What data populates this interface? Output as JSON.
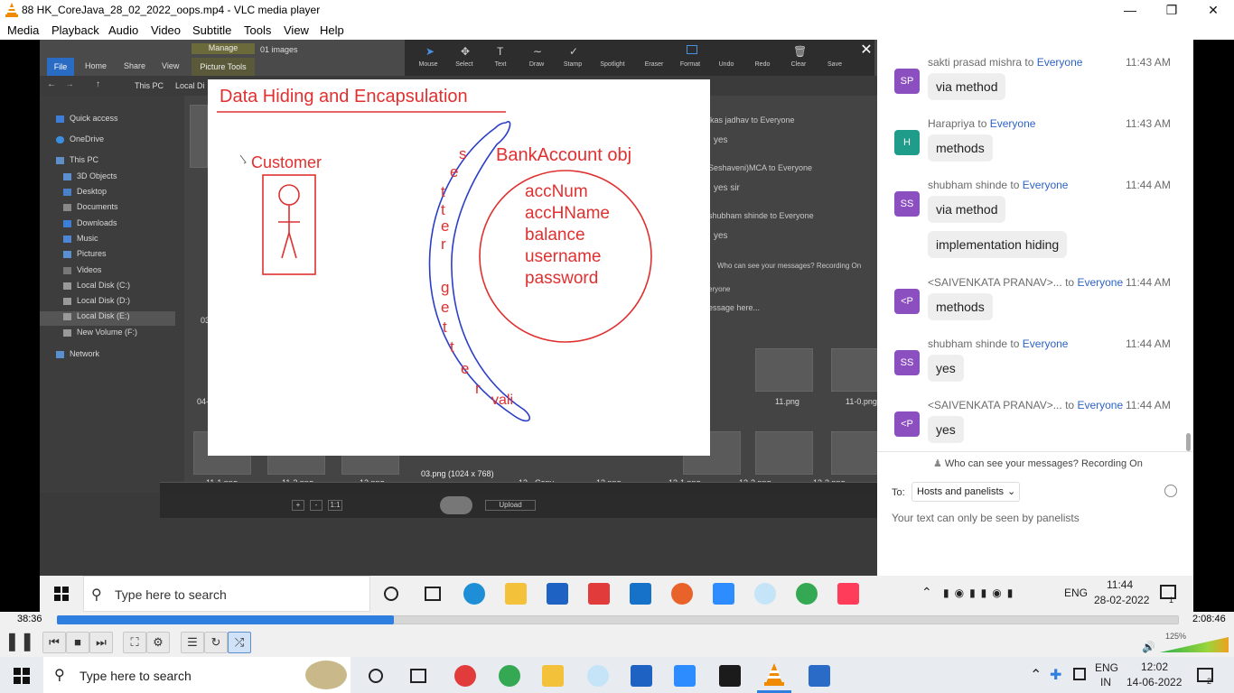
{
  "window": {
    "title": "88 HK_CoreJava_28_02_2022_oops.mp4 - VLC media player"
  },
  "menu": [
    "Media",
    "Playback",
    "Audio",
    "Video",
    "Subtitle",
    "Tools",
    "View",
    "Help"
  ],
  "explorer": {
    "ribbon_tabs": [
      "File",
      "Home",
      "Share",
      "View",
      "Picture Tools"
    ],
    "manage_label": "Manage",
    "images_count": "01 images",
    "path": [
      "This PC",
      "Local Di"
    ],
    "sidebar": [
      "Quick access",
      "OneDrive",
      "This PC",
      "3D Objects",
      "Desktop",
      "Documents",
      "Downloads",
      "Music",
      "Pictures",
      "Videos",
      "Local Disk (C:)",
      "Local Disk (D:)",
      "Local Disk (E:)",
      "New Volume (F:)",
      "Network"
    ],
    "thumbs": [
      "11.png",
      "11-0.png",
      "11-1.png",
      "11-2.png",
      "12.png",
      "13 - Copy -",
      "13.png",
      "13-1.png",
      "13-2.png",
      "13-3.png",
      "04-2",
      "03"
    ],
    "photo_caption": "03.png (1024 x 768)",
    "upload": "Upload",
    "zoom_label": "1:1"
  },
  "annot_tools": [
    "Mouse",
    "Select",
    "Text",
    "Draw",
    "Stamp",
    "Spotlight",
    "Eraser",
    "Format",
    "Undo",
    "Redo",
    "Clear",
    "Save"
  ],
  "behind_chat": [
    "ikas jadhav to Everyone",
    "yes",
    "Seshaveni)MCA to Everyone",
    "yes sir",
    "shubham shinde to Everyone",
    "yes",
    "Who can see your messages? Recording On",
    "eryone",
    "essage here..."
  ],
  "slide": {
    "title": "Data Hiding and Encapsulation",
    "customer": "Customer",
    "object": "BankAccount obj",
    "fields": [
      "accNum",
      "accHName",
      "balance",
      "username",
      "password"
    ],
    "setter": [
      "s",
      "e",
      "t",
      "t",
      "e",
      "r"
    ],
    "getter": [
      "g",
      "e",
      "t",
      "t",
      "e",
      "r"
    ],
    "vali": "vali"
  },
  "chat": {
    "messages": [
      {
        "initials": "SP",
        "color": "#8c4fc0",
        "sender": "sakti prasad mishra",
        "time": "11:43 AM",
        "bubbles": [
          "via method"
        ]
      },
      {
        "initials": "H",
        "color": "#1f9d8a",
        "sender": "Harapriya",
        "time": "11:43 AM",
        "bubbles": [
          "methods"
        ]
      },
      {
        "initials": "SS",
        "color": "#8c4fc0",
        "sender": "shubham shinde",
        "time": "11:44 AM",
        "bubbles": [
          "via method",
          "implementation hiding"
        ]
      },
      {
        "initials": "<P",
        "color": "#8c4fc0",
        "sender": "<SAIVENKATA PRANAV>...",
        "time": "11:44 AM",
        "bubbles": [
          "methods"
        ]
      },
      {
        "initials": "SS",
        "color": "#8c4fc0",
        "sender": "shubham shinde",
        "time": "11:44 AM",
        "bubbles": [
          "yes"
        ]
      },
      {
        "initials": "<P",
        "color": "#8c4fc0",
        "sender": "<SAIVENKATA PRANAV>...",
        "time": "11:44 AM",
        "bubbles": [
          "yes"
        ]
      }
    ],
    "to_word": "to",
    "everyone": "Everyone",
    "privacy": "Who can see your messages? Recording On",
    "to_label": "To:",
    "recipient": "Hosts and panelists",
    "notice": "Your text can only be seen by panelists"
  },
  "recorded_taskbar": {
    "search": "Type here to search",
    "lang": "ENG",
    "time": "11:44",
    "date": "28-02-2022",
    "notif": "1"
  },
  "player": {
    "elapsed": "38:36",
    "total": "2:08:46",
    "progress": 0.3,
    "volume": "125%"
  },
  "taskbar": {
    "search": "Type here to search",
    "lang1": "ENG",
    "lang2": "IN",
    "time": "12:02",
    "date": "14-06-2022",
    "notif": "2"
  }
}
